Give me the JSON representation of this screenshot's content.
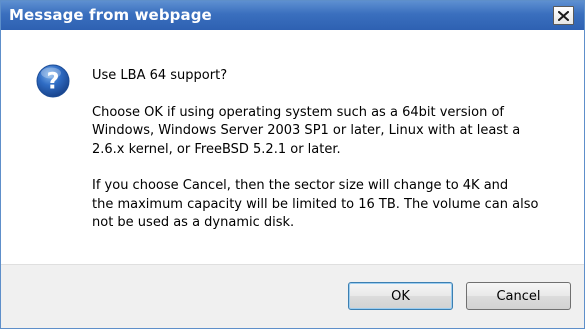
{
  "window": {
    "title": "Message from webpage"
  },
  "message": {
    "question": "Use LBA 64 support?",
    "paragraph1": "Choose OK if using operating system such as a 64bit version of\nWindows, Windows Server 2003 SP1 or later, Linux with at least a\n2.6.x kernel, or FreeBSD 5.2.1 or later.",
    "paragraph2": "If you choose Cancel, then the sector size will change to 4K and\nthe maximum capacity will be limited to 16 TB. The volume can also\nnot be used as a dynamic disk."
  },
  "buttons": {
    "ok_label": "OK",
    "cancel_label": "Cancel"
  },
  "icons": {
    "dialog_icon": "question-icon",
    "close_icon": "close-icon"
  },
  "colors": {
    "titlebar": "#3a6fbe",
    "question_icon": "#2a63b8"
  }
}
